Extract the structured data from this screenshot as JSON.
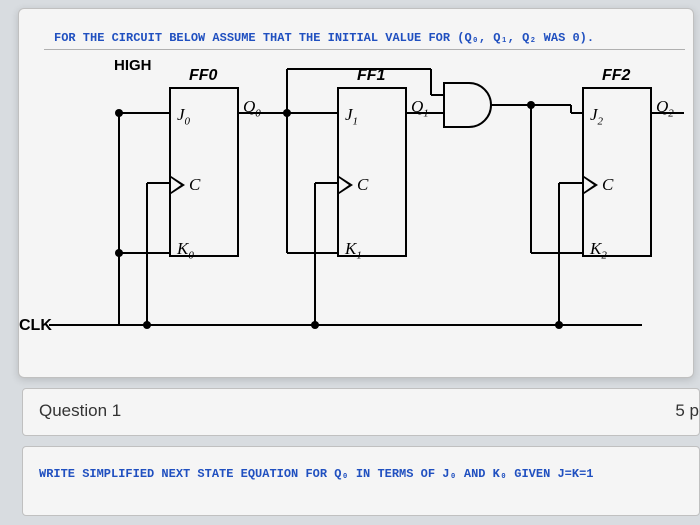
{
  "instruction_top": "FOR THE CIRCUIT BELOW ASSUME THAT THE INITIAL VALUE FOR (Q₀, Q₁, Q₂ WAS 0).",
  "labels": {
    "high": "HIGH",
    "clk": "CLK",
    "ff0": "FF0",
    "ff1": "FF1",
    "ff2": "FF2"
  },
  "pins": {
    "j0": "J",
    "j0s": "0",
    "c": "C",
    "k0": "K",
    "k0s": "0",
    "q0": "Q",
    "q0s": "0",
    "j1": "J",
    "j1s": "1",
    "k1": "K",
    "k1s": "1",
    "q1": "Q",
    "q1s": "1",
    "j2": "J",
    "j2s": "2",
    "k2": "K",
    "k2s": "2",
    "q2": "Q",
    "q2s": "2"
  },
  "question": {
    "title": "Question 1",
    "points": "5 p"
  },
  "prompt": "WRITE SIMPLIFIED NEXT STATE EQUATION FOR Q₀ IN TERMS OF J₀ AND K₀ GIVEN J=K=1"
}
